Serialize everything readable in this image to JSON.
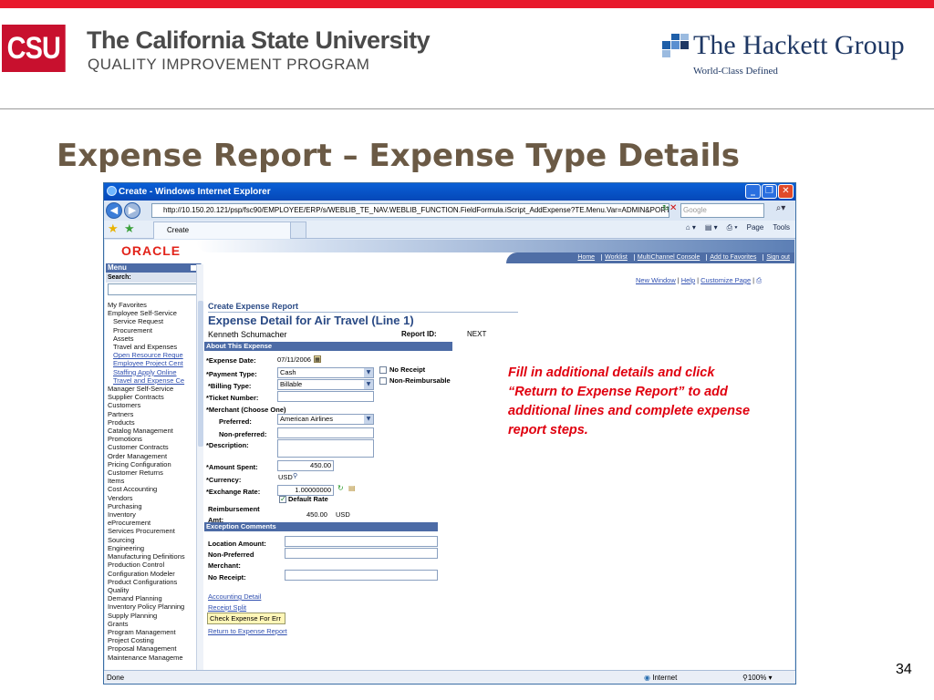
{
  "header": {
    "csu_logo": "CSU",
    "csu_name": "The California State University",
    "csu_program": "QUALITY IMPROVEMENT PROGRAM",
    "hackett_name": "The Hackett Group",
    "hackett_tagline": "World-Class Defined"
  },
  "slide": {
    "title": "Expense Report – Expense Type Details",
    "page_number": "34",
    "callout": "Fill in additional details and click “Return to Expense Report” to add additional lines and complete expense report steps."
  },
  "browser": {
    "window_title": "Create - Windows Internet Explorer",
    "url": "http://10.150.20.121/psp/fsc90/EMPLOYEE/ERP/s/WEBLIB_TE_NAV.WEBLIB_FUNCTION.FieldFormula.iScript_AddExpense?TE.Menu.Var=ADMIN&PORTALI",
    "search_placeholder": "Google",
    "tab_label": "Create",
    "cmd_page": "Page",
    "cmd_tools": "Tools",
    "status_text": "Done",
    "zone": "Internet",
    "zoom": "100%"
  },
  "peoplesoft": {
    "brand": "ORACLE",
    "header_links": [
      "Home",
      "Worklist",
      "MultiChannel Console",
      "Add to Favorites",
      "Sign out"
    ],
    "page_links": [
      "New Window",
      "Help",
      "Customize Page"
    ],
    "menu_title": "Menu",
    "menu_search_label": "Search:",
    "menu_items": [
      {
        "label": "My Favorites",
        "level": 0,
        "link": false
      },
      {
        "label": "Employee Self-Service",
        "level": 0,
        "link": false
      },
      {
        "label": "Service Request",
        "level": 1,
        "link": false
      },
      {
        "label": "Procurement",
        "level": 1,
        "link": false
      },
      {
        "label": "Assets",
        "level": 1,
        "link": false
      },
      {
        "label": "Travel and Expenses",
        "level": 1,
        "link": false
      },
      {
        "label": "Open Resource Reque",
        "level": 1,
        "link": true
      },
      {
        "label": "Employee Project Cent",
        "level": 1,
        "link": true
      },
      {
        "label": "Staffing Apply Online",
        "level": 1,
        "link": true
      },
      {
        "label": "Travel and Expense Ce",
        "level": 1,
        "link": true
      },
      {
        "label": "Manager Self-Service",
        "level": 0,
        "link": false
      },
      {
        "label": "Supplier Contracts",
        "level": 0,
        "link": false
      },
      {
        "label": "Customers",
        "level": 0,
        "link": false
      },
      {
        "label": "Partners",
        "level": 0,
        "link": false
      },
      {
        "label": "Products",
        "level": 0,
        "link": false
      },
      {
        "label": "Catalog Management",
        "level": 0,
        "link": false
      },
      {
        "label": "Promotions",
        "level": 0,
        "link": false
      },
      {
        "label": "Customer Contracts",
        "level": 0,
        "link": false
      },
      {
        "label": "Order Management",
        "level": 0,
        "link": false
      },
      {
        "label": "Pricing Configuration",
        "level": 0,
        "link": false
      },
      {
        "label": "Customer Returns",
        "level": 0,
        "link": false
      },
      {
        "label": "Items",
        "level": 0,
        "link": false
      },
      {
        "label": "Cost Accounting",
        "level": 0,
        "link": false
      },
      {
        "label": "Vendors",
        "level": 0,
        "link": false
      },
      {
        "label": "Purchasing",
        "level": 0,
        "link": false
      },
      {
        "label": "Inventory",
        "level": 0,
        "link": false
      },
      {
        "label": "eProcurement",
        "level": 0,
        "link": false
      },
      {
        "label": "Services Procurement",
        "level": 0,
        "link": false
      },
      {
        "label": "Sourcing",
        "level": 0,
        "link": false
      },
      {
        "label": "Engineering",
        "level": 0,
        "link": false
      },
      {
        "label": "Manufacturing Definitions",
        "level": 0,
        "link": false
      },
      {
        "label": "Production Control",
        "level": 0,
        "link": false
      },
      {
        "label": "Configuration Modeler",
        "level": 0,
        "link": false
      },
      {
        "label": "Product Configurations",
        "level": 0,
        "link": false
      },
      {
        "label": "Quality",
        "level": 0,
        "link": false
      },
      {
        "label": "Demand Planning",
        "level": 0,
        "link": false
      },
      {
        "label": "Inventory Policy Planning",
        "level": 0,
        "link": false
      },
      {
        "label": "Supply Planning",
        "level": 0,
        "link": false
      },
      {
        "label": "Grants",
        "level": 0,
        "link": false
      },
      {
        "label": "Program Management",
        "level": 0,
        "link": false
      },
      {
        "label": "Project Costing",
        "level": 0,
        "link": false
      },
      {
        "label": "Proposal Management",
        "level": 0,
        "link": false
      },
      {
        "label": "Maintenance Manageme",
        "level": 0,
        "link": false
      }
    ]
  },
  "form": {
    "create_title": "Create Expense Report",
    "detail_title": "Expense Detail for Air Travel (Line 1)",
    "employee_name": "Kenneth Schumacher",
    "report_id_label": "Report ID:",
    "report_id_value": "NEXT",
    "about_section": "About This Expense",
    "expense_date_label": "*Expense Date:",
    "expense_date_value": "07/11/2006",
    "payment_type_label": "*Payment Type:",
    "payment_type_value": "Cash",
    "no_receipt_label": "No Receipt",
    "billing_type_label": "*Billing Type:",
    "billing_type_value": "Billable",
    "non_reimbursable_label": "Non-Reimbursable",
    "ticket_number_label": "*Ticket Number:",
    "ticket_number_value": "",
    "merchant_label": "*Merchant (Choose One)",
    "preferred_label": "Preferred:",
    "preferred_value": "American Airlines",
    "non_preferred_label": "Non-preferred:",
    "non_preferred_value": "",
    "description_label": "*Description:",
    "description_value": "",
    "amount_spent_label": "*Amount Spent:",
    "amount_spent_value": "450.00",
    "currency_label": "*Currency:",
    "currency_value": "USD",
    "exchange_rate_label": "*Exchange Rate:",
    "exchange_rate_value": "1.00000000",
    "default_rate_label": "Default Rate",
    "default_rate_checked": true,
    "reimbursement_label_1": "Reimbursement",
    "reimbursement_label_2": "Amt:",
    "reimbursement_value": "450.00",
    "reimbursement_currency": "USD",
    "exception_section": "Exception Comments",
    "location_amount_label": "Location Amount:",
    "non_preferred_merchant_label_1": "Non-Preferred",
    "non_preferred_merchant_label_2": "Merchant:",
    "no_receipt_comment_label": "No Receipt:",
    "accounting_detail_link": "Accounting Detail",
    "receipt_split_link": "Receipt Split",
    "check_expense_button": "Check Expense For Err",
    "return_link": "Return to Expense Report"
  },
  "colors": {
    "brand_red": "#e8192c",
    "title_brown": "#6b5a45",
    "ps_blue": "#4c6ba6",
    "callout_red": "#e0000f"
  }
}
